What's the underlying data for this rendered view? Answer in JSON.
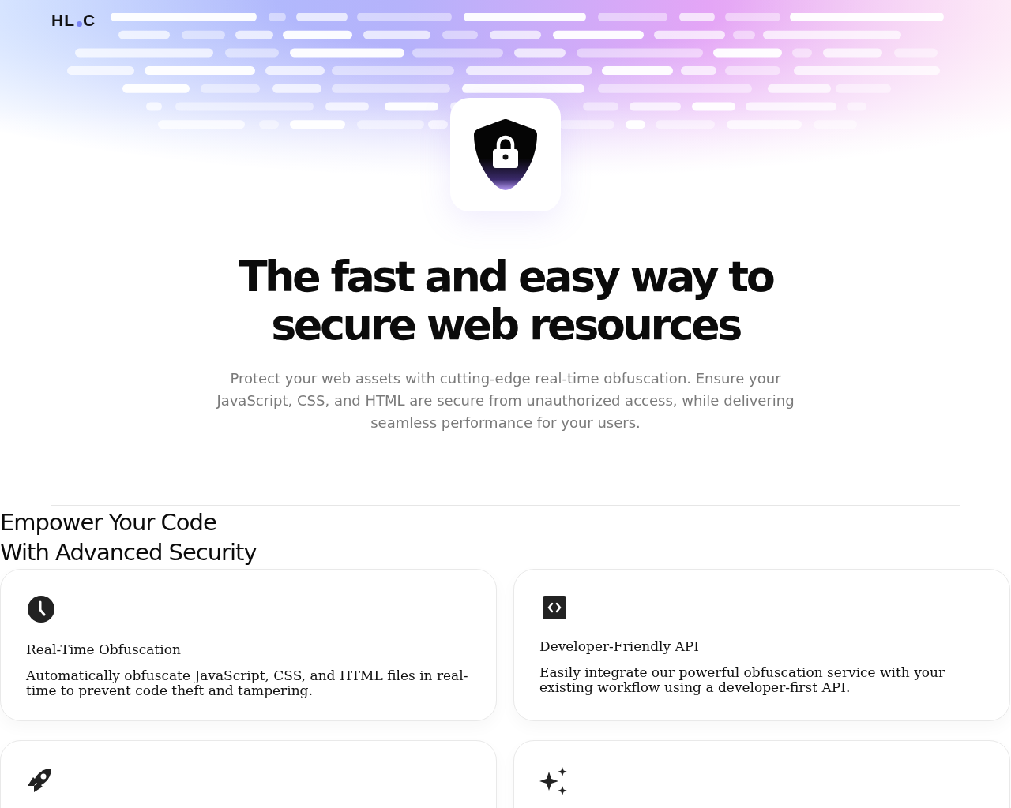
{
  "logo": [
    "HL",
    "C"
  ],
  "hero": {
    "title_lines": [
      "The fast and easy way to",
      "secure web resources"
    ],
    "subtitle": "Protect your web assets with cutting-edge real-time obfuscation. Ensure your JavaScript, CSS, and HTML are secure from unauthorized access, while delivering seamless performance for your users."
  },
  "features": {
    "heading_lines": [
      "Empower Your Code",
      "With Advanced Security"
    ],
    "cards": [
      {
        "kind": "clock",
        "title": "Real-Time Obfuscation",
        "description": "Automatically obfuscate JavaScript, CSS, and HTML files in real-time to prevent code theft and tampering."
      },
      {
        "kind": "code",
        "title": "Developer-Friendly API",
        "description": "Easily integrate our powerful obfuscation service with your existing workflow using a developer-first API."
      },
      {
        "kind": "rocket"
      },
      {
        "kind": "sparkles"
      }
    ]
  }
}
